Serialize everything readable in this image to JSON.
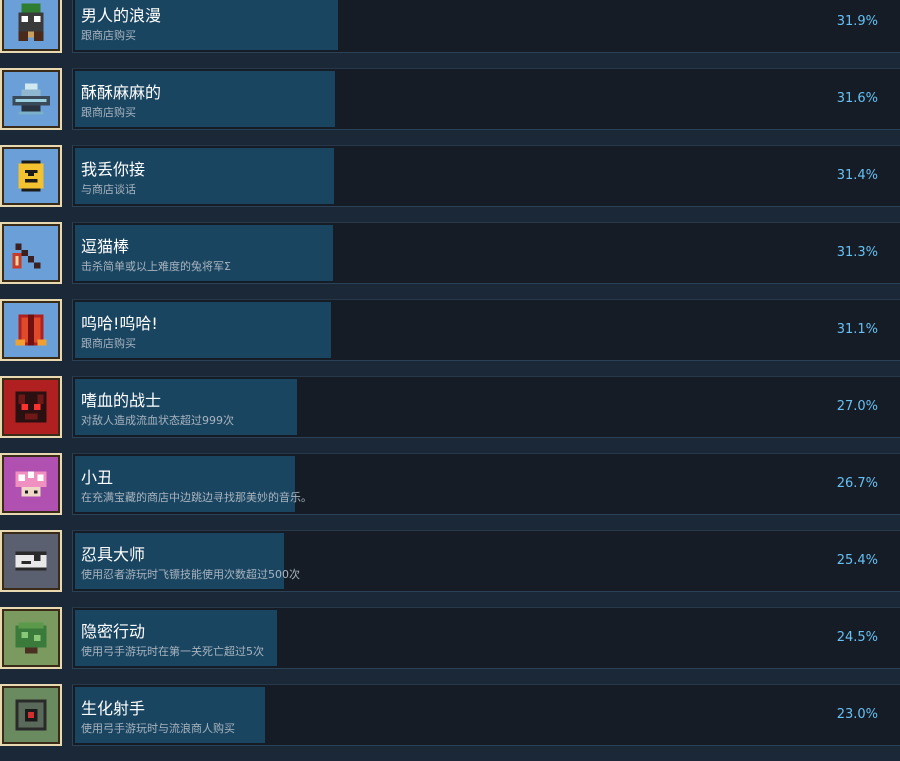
{
  "achievements": [
    {
      "title": "男人的浪漫",
      "desc": "跟商店购买",
      "percent": "31.9%",
      "progress": 0.319,
      "icon": "green-knight-icon",
      "icon_bg": "#6a9fd8"
    },
    {
      "title": "酥酥麻麻的",
      "desc": "跟商店购买",
      "percent": "31.6%",
      "progress": 0.316,
      "icon": "ufo-icon",
      "icon_bg": "#6a9fd8"
    },
    {
      "title": "我丢你接",
      "desc": "与商店谈话",
      "percent": "31.4%",
      "progress": 0.314,
      "icon": "yellow-ball-icon",
      "icon_bg": "#6a9fd8"
    },
    {
      "title": "逗猫棒",
      "desc": "击杀简单或以上难度的兔将军Σ",
      "percent": "31.3%",
      "progress": 0.313,
      "icon": "cat-teaser-icon",
      "icon_bg": "#6a9fd8"
    },
    {
      "title": "呜哈!呜哈!",
      "desc": "跟商店购买",
      "percent": "31.1%",
      "progress": 0.311,
      "icon": "red-cape-icon",
      "icon_bg": "#6a9fd8"
    },
    {
      "title": "嗜血的战士",
      "desc": "对敌人造成流血状态超过999次",
      "percent": "27.0%",
      "progress": 0.27,
      "icon": "blood-warrior-icon",
      "icon_bg": "#b02020"
    },
    {
      "title": "小丑",
      "desc": "在充满宝藏的商店中边跳边寻找那美妙的音乐。",
      "percent": "26.7%",
      "progress": 0.267,
      "icon": "clown-mushroom-icon",
      "icon_bg": "#b050b0"
    },
    {
      "title": "忍具大师",
      "desc": "使用忍者游玩时飞镖技能使用次数超过500次",
      "percent": "25.4%",
      "progress": 0.254,
      "icon": "ninja-icon",
      "icon_bg": "#5a6070"
    },
    {
      "title": "隐密行动",
      "desc": "使用弓手游玩时在第一关死亡超过5次",
      "percent": "24.5%",
      "progress": 0.245,
      "icon": "bush-icon",
      "icon_bg": "#7a9a60"
    },
    {
      "title": "生化射手",
      "desc": "使用弓手游玩时与流浪商人购买",
      "percent": "23.0%",
      "progress": 0.23,
      "icon": "box-robot-icon",
      "icon_bg": "#6a8a60"
    }
  ]
}
